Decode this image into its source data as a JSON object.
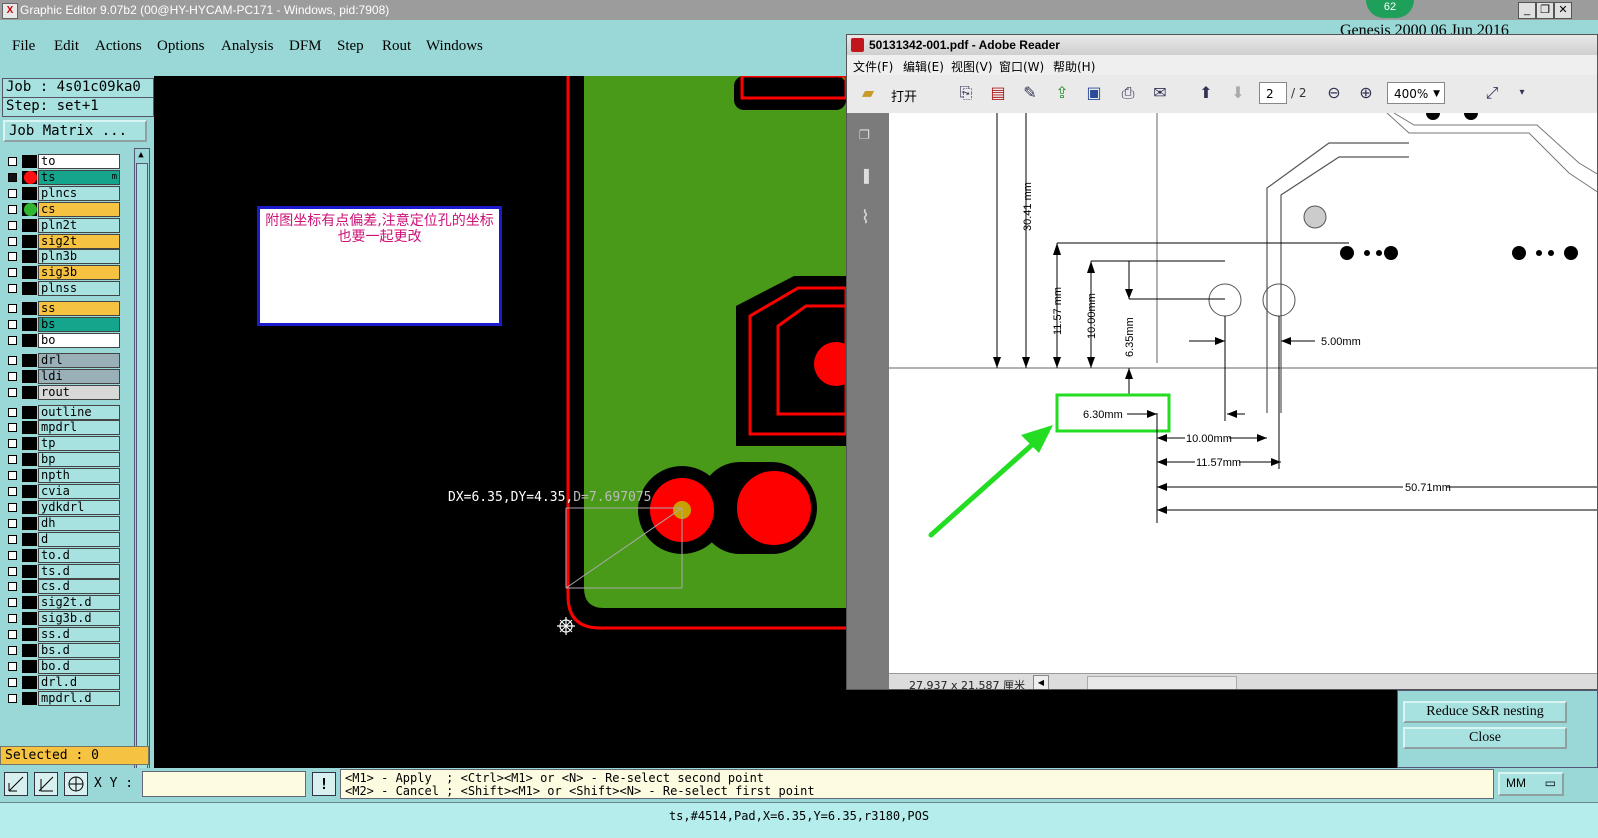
{
  "titlebar": {
    "title": "Graphic Editor 9.07b2 (00@HY-HYCAM-PC171 - Windows, pid:7908)",
    "badge": "62"
  },
  "menu": [
    "File",
    "Edit",
    "Actions",
    "Options",
    "Analysis",
    "DFM",
    "Step",
    "Rout",
    "Windows"
  ],
  "right_status": "Genesis 2000 06 Jun 2016",
  "job": {
    "job_label": "Job : 4s01c09ka0",
    "step_label": "Step: set+1",
    "matrix_button": "Job Matrix ..."
  },
  "layers": [
    {
      "name": "to",
      "bg": "#ffffff",
      "active": false,
      "dot": ""
    },
    {
      "name": "ts",
      "bg": "#14a58c",
      "active": true,
      "dot": "#ff1010",
      "marker": "m"
    },
    {
      "name": "plncs",
      "bg": "#a8e2e0",
      "active": false,
      "dot": ""
    },
    {
      "name": "cs",
      "bg": "#f5c242",
      "active": false,
      "dot": "#2fb52f"
    },
    {
      "name": "pln2t",
      "bg": "#a8e2e0",
      "active": false,
      "dot": ""
    },
    {
      "name": "sig2t",
      "bg": "#f5c242",
      "active": false,
      "dot": ""
    },
    {
      "name": "pln3b",
      "bg": "#a8e2e0",
      "active": false,
      "dot": ""
    },
    {
      "name": "sig3b",
      "bg": "#f5c242",
      "active": false,
      "dot": ""
    },
    {
      "name": "plnss",
      "bg": "#a8e2e0",
      "active": false,
      "dot": ""
    },
    {
      "name": "ss",
      "bg": "#f5c242",
      "active": false,
      "dot": ""
    },
    {
      "name": "bs",
      "bg": "#14a58c",
      "active": false,
      "dot": ""
    },
    {
      "name": "bo",
      "bg": "#ffffff",
      "active": false,
      "dot": ""
    },
    {
      "name": "drl",
      "bg": "#9ab0b8",
      "active": false,
      "dot": ""
    },
    {
      "name": "ldi",
      "bg": "#9ab0b8",
      "active": false,
      "dot": ""
    },
    {
      "name": "rout",
      "bg": "#d8d8d8",
      "active": false,
      "dot": ""
    },
    {
      "name": "outline",
      "bg": "#a8e2e0",
      "active": false,
      "dot": ""
    },
    {
      "name": "mpdrl",
      "bg": "#a8e2e0",
      "active": false,
      "dot": ""
    },
    {
      "name": "tp",
      "bg": "#a8e2e0",
      "active": false,
      "dot": ""
    },
    {
      "name": "bp",
      "bg": "#a8e2e0",
      "active": false,
      "dot": ""
    },
    {
      "name": "npth",
      "bg": "#a8e2e0",
      "active": false,
      "dot": ""
    },
    {
      "name": "cvia",
      "bg": "#a8e2e0",
      "active": false,
      "dot": ""
    },
    {
      "name": "ydkdrl",
      "bg": "#a8e2e0",
      "active": false,
      "dot": ""
    },
    {
      "name": "dh",
      "bg": "#a8e2e0",
      "active": false,
      "dot": ""
    },
    {
      "name": "d",
      "bg": "#a8e2e0",
      "active": false,
      "dot": ""
    },
    {
      "name": "to.d",
      "bg": "#a8e2e0",
      "active": false,
      "dot": ""
    },
    {
      "name": "ts.d",
      "bg": "#a8e2e0",
      "active": false,
      "dot": ""
    },
    {
      "name": "cs.d",
      "bg": "#a8e2e0",
      "active": false,
      "dot": ""
    },
    {
      "name": "sig2t.d",
      "bg": "#a8e2e0",
      "active": false,
      "dot": ""
    },
    {
      "name": "sig3b.d",
      "bg": "#a8e2e0",
      "active": false,
      "dot": ""
    },
    {
      "name": "ss.d",
      "bg": "#a8e2e0",
      "active": false,
      "dot": ""
    },
    {
      "name": "bs.d",
      "bg": "#a8e2e0",
      "active": false,
      "dot": ""
    },
    {
      "name": "bo.d",
      "bg": "#a8e2e0",
      "active": false,
      "dot": ""
    },
    {
      "name": "drl.d",
      "bg": "#a8e2e0",
      "active": false,
      "dot": ""
    },
    {
      "name": "mpdrl.d",
      "bg": "#a8e2e0",
      "active": false,
      "dot": ""
    }
  ],
  "selected_label": "Selected : 0",
  "canvas": {
    "note_text": "附图坐标有点偏差,注意定位孔的坐标也要一起更改",
    "measure_main": "DX=6.35,DY=4.35,",
    "measure_dist": "D=7.697075"
  },
  "reader": {
    "title": "50131342-001.pdf - Adobe Reader",
    "menu": [
      "文件(F)",
      "编辑(E)",
      "视图(V)",
      "窗口(W)",
      "帮助(H)"
    ],
    "open_label": "打开",
    "page_current": "2",
    "page_total": "/ 2",
    "zoom": "400%",
    "page_size": "27.937 x 21.587 厘米",
    "dims": {
      "d30_41": "30.41 mm",
      "d11_57v": "11.57 mm",
      "d10_00v": "10.00mm",
      "d6_35": "6.35mm",
      "d5_00": "5.00mm",
      "d6_30": "6.30mm",
      "d10_00h": "10.00mm",
      "d11_57h": "11.57mm",
      "d50_71": "50.71mm"
    }
  },
  "popup": {
    "reduce": "Reduce S&R nesting",
    "close": "Close"
  },
  "bottom": {
    "xy_label": "X Y :",
    "hint1": "<M1> - Apply  ; <Ctrl><M1> or <N> - Re-select second point",
    "hint2": "<M2> - Cancel ; <Shift><M1> or <Shift><N> - Re-select first point",
    "unit": "MM"
  },
  "status": "ts,#4514,Pad,X=6.35,Y=6.35,r3180,POS",
  "colors": {
    "ui_bg": "#99d8d6",
    "pcb_green": "#4a9a1a",
    "pad_red": "#ff0000",
    "highlight_green": "#22dd22"
  }
}
